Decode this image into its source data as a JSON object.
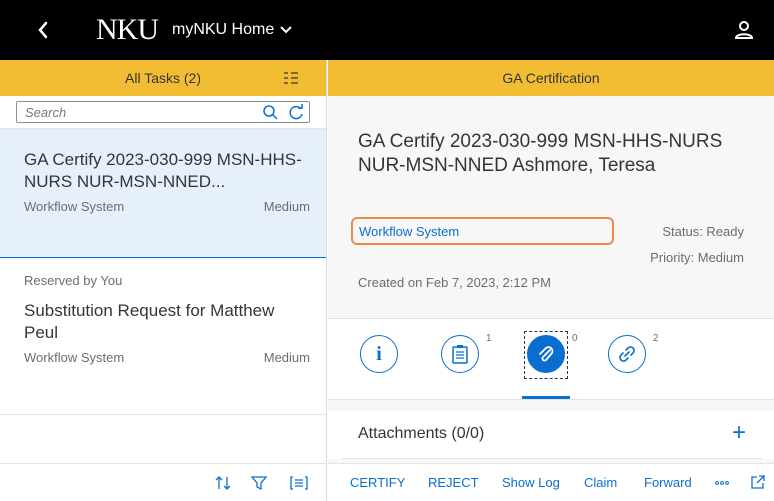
{
  "shell": {
    "logo_text": "NKU",
    "app_title": "myNKU Home"
  },
  "left": {
    "header_title": "All Tasks (2)",
    "search_placeholder": "Search",
    "tasks": [
      {
        "title": "GA Certify 2023-030-999 MSN-HHS-NURS NUR-MSN-NNED...",
        "source": "Workflow System",
        "priority": "Medium"
      },
      {
        "reserved": "Reserved by You",
        "title": "Substitution Request for Matthew Peul",
        "source": "Workflow System",
        "priority": "Medium"
      }
    ]
  },
  "right": {
    "header_title": "GA Certification",
    "detail_title": "GA Certify 2023-030-999 MSN-HHS-NURS NUR-MSN-NNED Ashmore, Teresa",
    "workflow_link": "Workflow System",
    "status": "Status: Ready",
    "priority": "Priority: Medium",
    "created": "Created on Feb 7, 2023, 2:12 PM",
    "tabs": [
      {
        "name": "info",
        "count": ""
      },
      {
        "name": "notes",
        "count": "1"
      },
      {
        "name": "attachments",
        "count": "0"
      },
      {
        "name": "links",
        "count": "2"
      }
    ],
    "attachments_title": "Attachments (0/0)",
    "attachments_add": "+",
    "footer": {
      "certify": "CERTIFY",
      "reject": "REJECT",
      "show_log": "Show Log",
      "claim": "Claim",
      "forward": "Forward"
    }
  },
  "colors": {
    "accent": "#0a6ed1",
    "header": "#f2bd33",
    "shell": "#000000",
    "highlight": "#f08a4b"
  }
}
